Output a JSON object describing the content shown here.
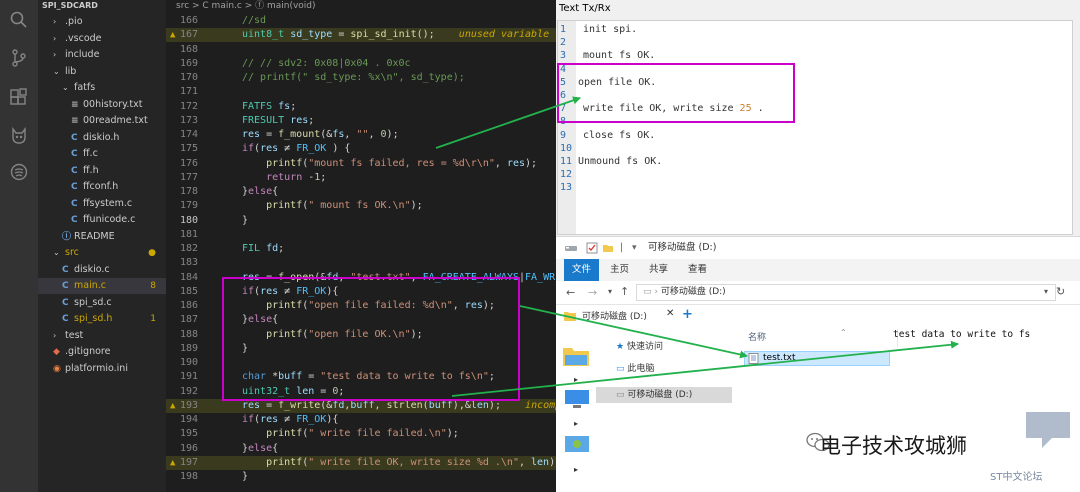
{
  "explorer": {
    "header": "SPI_SDCARD",
    "items": [
      {
        "label": ".pio",
        "depth": 1,
        "type": "folder-closed"
      },
      {
        "label": ".vscode",
        "depth": 1,
        "type": "folder-closed"
      },
      {
        "label": "include",
        "depth": 1,
        "type": "folder-closed"
      },
      {
        "label": "lib",
        "depth": 1,
        "type": "folder-open"
      },
      {
        "label": "fatfs",
        "depth": 2,
        "type": "folder-open"
      },
      {
        "label": "00history.txt",
        "depth": 3,
        "type": "text"
      },
      {
        "label": "00readme.txt",
        "depth": 3,
        "type": "text"
      },
      {
        "label": "diskio.h",
        "depth": 3,
        "type": "c"
      },
      {
        "label": "ff.c",
        "depth": 3,
        "type": "c"
      },
      {
        "label": "ff.h",
        "depth": 3,
        "type": "c"
      },
      {
        "label": "ffconf.h",
        "depth": 3,
        "type": "c"
      },
      {
        "label": "ffsystem.c",
        "depth": 3,
        "type": "c"
      },
      {
        "label": "ffunicode.c",
        "depth": 3,
        "type": "c"
      },
      {
        "label": "README",
        "depth": 2,
        "type": "info"
      },
      {
        "label": "src",
        "depth": 1,
        "type": "folder-open",
        "badge": "●"
      },
      {
        "label": "diskio.c",
        "depth": 2,
        "type": "c"
      },
      {
        "label": "main.c",
        "depth": 2,
        "type": "c",
        "badge": "8",
        "selected": true
      },
      {
        "label": "spi_sd.c",
        "depth": 2,
        "type": "c"
      },
      {
        "label": "spi_sd.h",
        "depth": 2,
        "type": "c",
        "badge": "1"
      },
      {
        "label": "test",
        "depth": 1,
        "type": "folder-closed"
      },
      {
        "label": ".gitignore",
        "depth": 1,
        "type": "git"
      },
      {
        "label": "platformio.ini",
        "depth": 1,
        "type": "pio"
      }
    ]
  },
  "editor": {
    "breadcrumb": "src > C main.c > ⓕ main(void)",
    "lines": [
      {
        "n": "166",
        "html": "<span class=\"cm\">//sd</span>"
      },
      {
        "n": "167",
        "html": "<span class=\"ty\">uint8_t</span> <span class=\"vr\">sd_type</span> = <span class=\"fn\">spi_sd_init</span>();    <span class=\"hint\">unused variable</span>",
        "warn": true
      },
      {
        "n": "168",
        "html": ""
      },
      {
        "n": "169",
        "html": "<span class=\"cm\">// // sdv2: 0x08|0x04 . 0x0c</span>"
      },
      {
        "n": "170",
        "html": "<span class=\"cm\">// printf(\" sd_type: %x\\n\", sd_type);</span>"
      },
      {
        "n": "171",
        "html": ""
      },
      {
        "n": "172",
        "html": "<span class=\"ty\">FATFS</span> <span class=\"vr\">fs</span>;"
      },
      {
        "n": "173",
        "html": "<span class=\"ty\">FRESULT</span> <span class=\"vr\">res</span>;"
      },
      {
        "n": "174",
        "html": "<span class=\"vr\">res</span> = <span class=\"fn\">f_mount</span>(&amp;<span class=\"vr\">fs</span>, <span class=\"st\">\"\"</span>, <span class=\"nm\">0</span>);"
      },
      {
        "n": "175",
        "html": "<span class=\"ctl\">if</span>(<span class=\"vr\">res</span> ≠ <span class=\"mc\">FR_OK</span> ) {"
      },
      {
        "n": "176",
        "html": "    <span class=\"fn\">printf</span>(<span class=\"st\">\"mount fs failed, res = %d\\r\\n\"</span>, <span class=\"vr\">res</span>);"
      },
      {
        "n": "177",
        "html": "    <span class=\"ctl\">return</span> -<span class=\"nm\">1</span>;"
      },
      {
        "n": "178",
        "html": "}<span class=\"ctl\">else</span>{"
      },
      {
        "n": "179",
        "html": "    <span class=\"fn\">printf</span>(<span class=\"st\">\" mount fs OK.\\n\"</span>);"
      },
      {
        "n": "180",
        "html": "}",
        "current": true
      },
      {
        "n": "181",
        "html": ""
      },
      {
        "n": "182",
        "html": "<span class=\"ty\">FIL</span> <span class=\"vr\">fd</span>;"
      },
      {
        "n": "183",
        "html": ""
      },
      {
        "n": "184",
        "html": "<span class=\"vr\">res</span> = <span class=\"fn\">f_open</span>(&amp;<span class=\"vr\">fd</span>, <span class=\"st\">\"test.txt\"</span>, <span class=\"mc\">FA_CREATE_ALWAYS</span>|<span class=\"mc\">FA_WRITE</span>);"
      },
      {
        "n": "185",
        "html": "<span class=\"ctl\">if</span>(<span class=\"vr\">res</span> ≠ <span class=\"mc\">FR_OK</span>){"
      },
      {
        "n": "186",
        "html": "    <span class=\"fn\">printf</span>(<span class=\"st\">\"open file failed: %d\\n\"</span>, <span class=\"vr\">res</span>);"
      },
      {
        "n": "187",
        "html": "}<span class=\"ctl\">else</span>{"
      },
      {
        "n": "188",
        "html": "    <span class=\"fn\">printf</span>(<span class=\"st\">\"open file OK.\\n\"</span>);"
      },
      {
        "n": "189",
        "html": "}"
      },
      {
        "n": "190",
        "html": ""
      },
      {
        "n": "191",
        "html": "<span class=\"kw\">char</span> *<span class=\"vr\">buff</span> = <span class=\"st\">\"test data to write to fs\\n\"</span>;"
      },
      {
        "n": "192",
        "html": "<span class=\"ty\">uint32_t</span> <span class=\"vr\">len</span> = <span class=\"nm\">0</span>;"
      },
      {
        "n": "193",
        "html": "<span class=\"vr\">res</span> = <span class=\"fn\">f_write</span>(&amp;<span class=\"vr\">fd</span>,<span class=\"vr\">buff</span>, <span class=\"fn\">strlen</span>(<span class=\"vr\">buff</span>),&amp;<span class=\"vr\">len</span>);    <span class=\"hint\">incompatible</span>",
        "warn": true
      },
      {
        "n": "194",
        "html": "<span class=\"ctl\">if</span>(<span class=\"vr\">res</span> ≠ <span class=\"mc\">FR_OK</span>){"
      },
      {
        "n": "195",
        "html": "    <span class=\"fn\">printf</span>(<span class=\"st\">\" write file failed.\\n\"</span>);"
      },
      {
        "n": "196",
        "html": "}<span class=\"ctl\">else</span>{"
      },
      {
        "n": "197",
        "html": "    <span class=\"fn\">printf</span>(<span class=\"st\">\" write file OK, write size %d .\\n\"</span>, <span class=\"vr\">len</span>);",
        "warn": true
      },
      {
        "n": "198",
        "html": "}"
      }
    ]
  },
  "serial": {
    "title": "Text Tx/Rx",
    "lines": [
      {
        "n": "1",
        "text": "init spi."
      },
      {
        "n": "2",
        "text": ""
      },
      {
        "n": "3",
        "text": "mount fs OK."
      },
      {
        "n": "4",
        "text": ""
      },
      {
        "n": "5",
        "text": "open file OK.",
        "flush": true
      },
      {
        "n": "6",
        "text": ""
      },
      {
        "n": "7",
        "text": "write file OK, write size ",
        "num": "25",
        "tail": " ."
      },
      {
        "n": "8",
        "text": ""
      },
      {
        "n": "9",
        "text": "close fs OK."
      },
      {
        "n": "10",
        "text": ""
      },
      {
        "n": "11",
        "text": "Unmound fs OK.",
        "flush": true
      },
      {
        "n": "12",
        "text": ""
      },
      {
        "n": "13",
        "text": ""
      }
    ]
  },
  "file_explorer": {
    "window_title": "可移动磁盘 (D:)",
    "ribbon_tabs": [
      "文件",
      "主页",
      "共享",
      "查看"
    ],
    "address": "可移动磁盘 (D:)",
    "tab_label": "可移动磁盘 (D:)",
    "nav": [
      "快速访问",
      "此电脑",
      "可移动磁盘 (D:)"
    ],
    "column_name": "名称",
    "file": "test.txt",
    "file_content": "test data to write to fs"
  },
  "watermark": {
    "text": "电子技术攻城狮",
    "sub": "ST中文论坛"
  },
  "colors": {
    "annotation_box": "#cc00cc",
    "arrow": "#22b14c"
  }
}
